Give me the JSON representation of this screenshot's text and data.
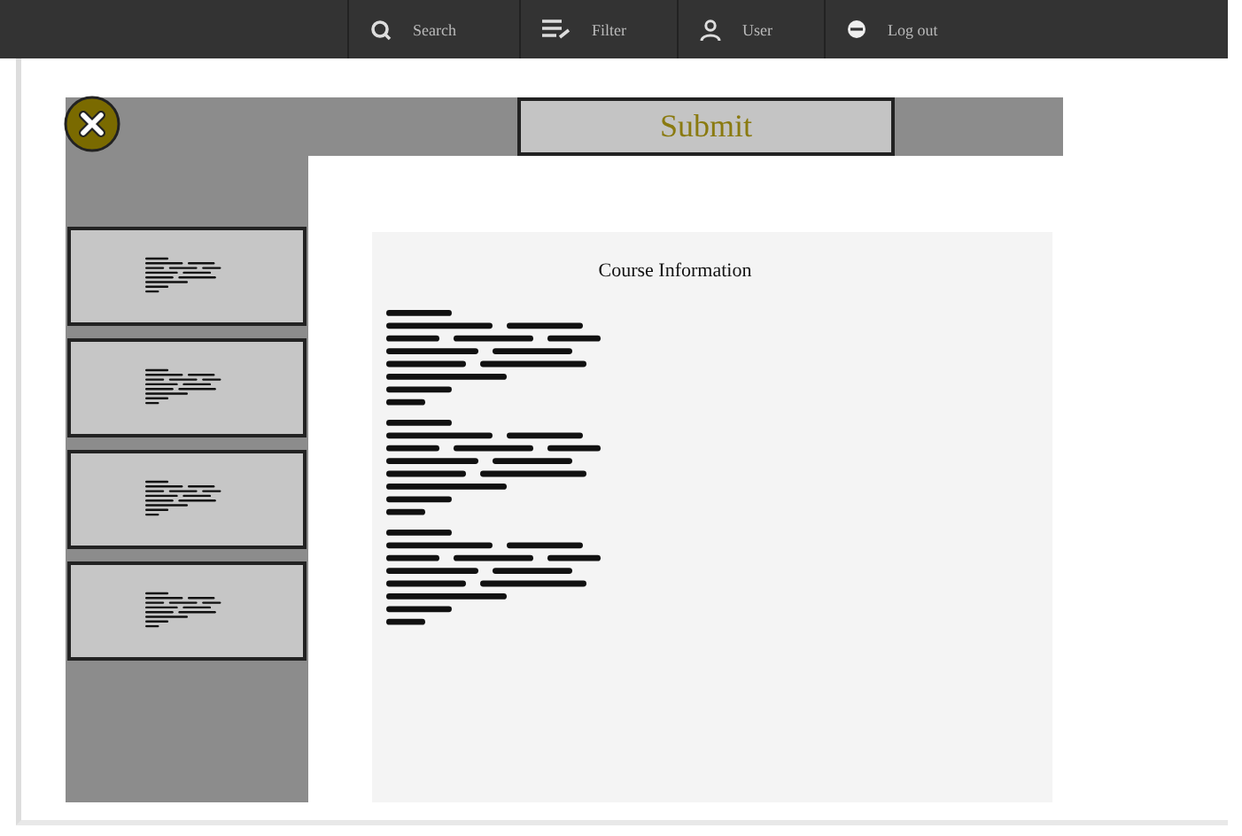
{
  "topbar": {
    "items": [
      {
        "kind": "search",
        "label": "Search"
      },
      {
        "kind": "filter",
        "label": "Filter"
      },
      {
        "kind": "user",
        "label": "User"
      },
      {
        "kind": "logout",
        "label": "Log out"
      }
    ]
  },
  "toolbar": {
    "submit": "Submit"
  },
  "content": {
    "title": "Course Information"
  }
}
